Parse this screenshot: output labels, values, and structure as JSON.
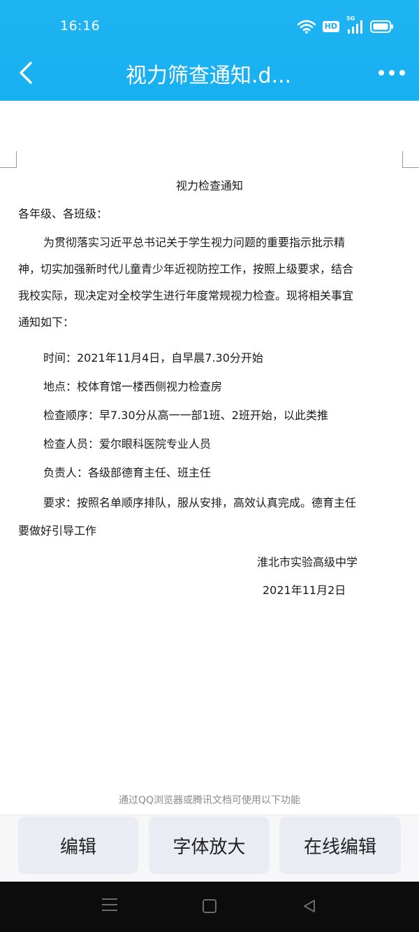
{
  "status_bar": {
    "time": "16:16",
    "hd_label": "HD",
    "signal_label": "5G"
  },
  "header": {
    "title": "视力筛查通知.d...",
    "back_icon": "chevron-left-icon",
    "more_icon": "more-horizontal-icon"
  },
  "document": {
    "title": "视力检查通知",
    "salutation": "各年级、各班级：",
    "intro_lines": [
      "为贯彻落实习近平总书记关于学生视力问题的重要指示批示精",
      "神，切实加强新时代儿童青少年近视防控工作，按照上级要求，结合",
      "我校实际，现决定对全校学生进行年度常规视力检查。现将相关事宜",
      "通知如下："
    ],
    "items": {
      "time": "时间：2021年11月4日，自早晨7.30分开始",
      "place": "地点：校体育馆一楼西侧视力检查房",
      "order": "检查顺序：早7.30分从高一一部1班、2班开始，以此类推",
      "examiners": "检查人员：爱尔眼科医院专业人员",
      "responsible": "负责人：各级部德育主任、班主任",
      "requirement": "要求：按照名单顺序排队，服从安排，高效认真完成。德育主任",
      "requirement_cont": "要做好引导工作"
    },
    "signer": "淮北市实验高级中学",
    "date": "2021年11月2日"
  },
  "footer": {
    "hint": "通过QQ浏览器或腾讯文档可使用以下功能",
    "buttons": {
      "edit": "编辑",
      "font_enlarge": "字体放大",
      "online_edit": "在线编辑"
    }
  },
  "colors": {
    "header_bg": "#17b0f1",
    "button_bg": "#e9ecf2",
    "nav_bg": "#0c0c0c"
  }
}
